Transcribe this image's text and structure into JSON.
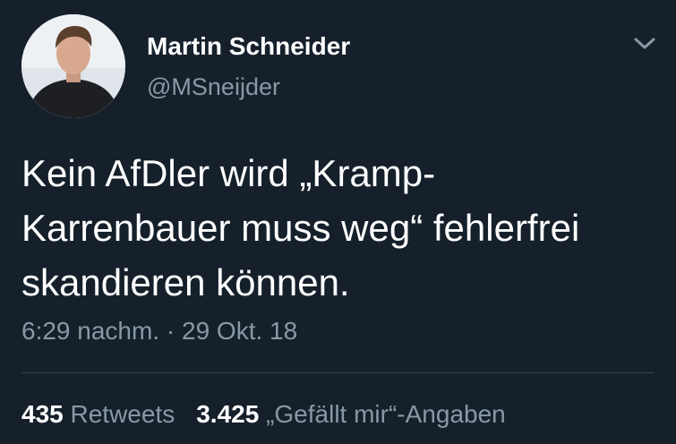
{
  "tweet": {
    "author_name": "Martin Schneider",
    "author_handle": "@MSneijder",
    "text_lines": [
      "Kein AfDler wird „Kramp-",
      "Karrenbauer muss weg“ fehlerfrei",
      "skandieren können."
    ],
    "time": "6:29 nachm.",
    "separator": "·",
    "date": "29 Okt. 18",
    "retweets_count": "435",
    "retweets_label": "Retweets",
    "likes_count": "3.425",
    "likes_label": "„Gefällt mir“-Angaben"
  },
  "icons": {
    "menu": "chevron-down-icon",
    "avatar": "avatar"
  },
  "colors": {
    "background": "#15202b",
    "primary_text": "#ffffff",
    "secondary_text": "#8899a6",
    "divider": "#38444d"
  }
}
